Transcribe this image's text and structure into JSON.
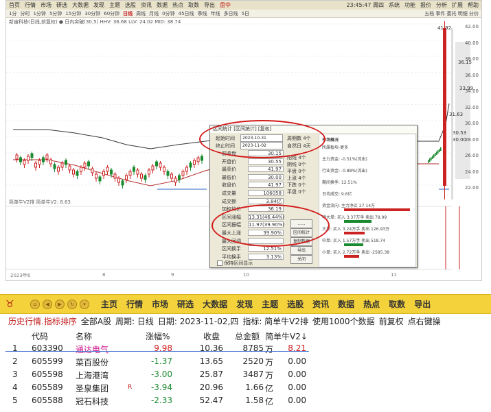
{
  "top_screenshot": {
    "menubar": {
      "items": [
        "首页",
        "行情",
        "市场",
        "研选",
        "大数据",
        "发现",
        "主题",
        "选股",
        "资讯",
        "数据",
        "热点",
        "取数",
        "导出",
        "盘中"
      ],
      "time": "23:45:47 周四",
      "right_items": [
        "系统",
        "功能",
        "报价",
        "分析",
        "扩展",
        "帮助"
      ]
    },
    "toolbar": {
      "periods": [
        "1分",
        "分时",
        "1分钟",
        "5分钟",
        "15分钟",
        "30分钟",
        "60分钟",
        "日线",
        "周线",
        "月线",
        "0分钟",
        "45日线",
        "季线",
        "年线",
        "多日线",
        "5日"
      ],
      "active_period": "日线",
      "right_text": "五档 事件 委托 明细 分价"
    },
    "stock_info": "新宙科技(日线,前复权)  ● 日内突破(30,5)  HHV: 36.68  LLV: 24.02  MID: 38.74",
    "indicator_label": "简单牛V2排  简单牛V2: 8.63",
    "price_axis": [
      "42.00",
      "40.00",
      "38.00",
      "36.00",
      "34.00",
      "32.00",
      "30.00",
      "28.00",
      "26.00",
      "24.00",
      "22.00"
    ],
    "annotations": [
      "41.92",
      "36.15",
      "33.99",
      "31.63",
      "30.53",
      "30.00"
    ],
    "date_axis": [
      "2023年6",
      "8",
      "9",
      "10",
      "11"
    ],
    "dialog": {
      "title": "区间统计 [区间统计] [复权]",
      "start_label": "起始时间",
      "start_value": "2023-10-31",
      "end_label": "终止时间",
      "end_value": "2023-11-02",
      "period_count": "周期数 4个",
      "natural_days": "自然日 4天",
      "stats": [
        {
          "label": "前收盘",
          "value": "30.15"
        },
        {
          "label": "开盘价",
          "value": "30.55"
        },
        {
          "label": "最高价",
          "value": "41.97"
        },
        {
          "label": "最低价",
          "value": "30.00"
        },
        {
          "label": "收盘价",
          "value": "41.97"
        },
        {
          "label": "成交量",
          "value": "106058"
        },
        {
          "label": "成交额",
          "value": "3.84亿"
        },
        {
          "label": "加权均价",
          "value": "36.19"
        },
        {
          "label": "区间涨幅",
          "value": "13.31(46.44%)"
        },
        {
          "label": "区间振幅",
          "value": "11.97(39.90%)"
        },
        {
          "label": "最大上涨",
          "value": "39.90%"
        },
        {
          "label": "最大回调",
          "value": ""
        },
        {
          "label": "区间换手",
          "value": "12.51%"
        },
        {
          "label": "平均换手",
          "value": "3.13%"
        }
      ],
      "side_counts": [
        "阳线 4个",
        "阴线 0个",
        "平盘 0个",
        "上涨 4个",
        "下跌 0个",
        "平盘 0个"
      ],
      "buttons": [
        "......",
        "区间统计",
        "复制数据",
        "导出",
        "关闭"
      ],
      "checkbox_label": "保持区间显示",
      "right_panel": {
        "title": "市场概况",
        "lines": [
          "所属板块-更多",
          "主力资金: -0.51%(流出)",
          "行业资金: -0.88%(流出)",
          "期间换手: 12.51%",
          "日均成交: 9.6亿",
          "资金流向: 主力净买 27.14万",
          "特大单: 买入 3.37万手  卖出 78.99",
          "大单: 买入 3.24万手  卖出 126.93万",
          "中单: 买入 1.57万手  卖出 518.74",
          "小单: 买入 2.72万手  卖出 -2585.38"
        ]
      }
    }
  },
  "bottom_screenshot": {
    "menubar": {
      "items": [
        "主页",
        "行情",
        "市场",
        "研选",
        "大数据",
        "发现",
        "主题",
        "选股",
        "资讯",
        "数据",
        "热点",
        "取数",
        "导出"
      ]
    },
    "title_bar": {
      "title": "历史行情.指标排序",
      "scope": "全部A股",
      "period": "周期: 日线",
      "date": "日期: 2023-11-02,四",
      "indicator": "指标: 简单牛V2排",
      "data_count": "使用1000个数据",
      "adjust": "前复权",
      "hint": "点右键操"
    },
    "columns": [
      "代码",
      "名称",
      "涨幅%",
      "收盘",
      "总金额",
      "简单牛V2↓"
    ],
    "rows": [
      {
        "idx": "1",
        "code": "603390",
        "name": "通达电气",
        "chg": "9.98",
        "close": "10.36",
        "amt": "8785",
        "unit": "万",
        "v2": "8.21",
        "tag": ""
      },
      {
        "idx": "2",
        "code": "605599",
        "name": "菜百股份",
        "chg": "-1.37",
        "close": "13.65",
        "amt": "2520",
        "unit": "万",
        "v2": "0.00",
        "tag": ""
      },
      {
        "idx": "3",
        "code": "605598",
        "name": "上海港湾",
        "chg": "-3.00",
        "close": "25.87",
        "amt": "3487",
        "unit": "万",
        "v2": "0.00",
        "tag": ""
      },
      {
        "idx": "4",
        "code": "605589",
        "name": "圣泉集团",
        "chg": "-3.94",
        "close": "20.96",
        "amt": "1.66",
        "unit": "亿",
        "v2": "0.00",
        "tag": "R"
      },
      {
        "idx": "5",
        "code": "605588",
        "name": "冠石科技",
        "chg": "-2.33",
        "close": "52.47",
        "amt": "1.58",
        "unit": "亿",
        "v2": "0.00",
        "tag": ""
      }
    ]
  }
}
